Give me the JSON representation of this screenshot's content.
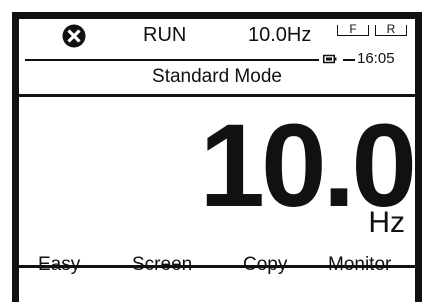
{
  "status": {
    "icon": "no-entry-icon",
    "run_label": "RUN",
    "frequency": "10.0Hz",
    "forward_label": "F",
    "reverse_label": "R",
    "battery_icon": "battery-icon",
    "time": "16:05"
  },
  "mode": {
    "title": "Standard Mode"
  },
  "main": {
    "value": "10.0",
    "unit": "Hz"
  },
  "softkeys": {
    "easy": "Easy",
    "screen": "Screen",
    "copy": "Copy",
    "monitor": "Monitor"
  },
  "colors": {
    "foreground": "#111111",
    "background": "#ffffff"
  }
}
